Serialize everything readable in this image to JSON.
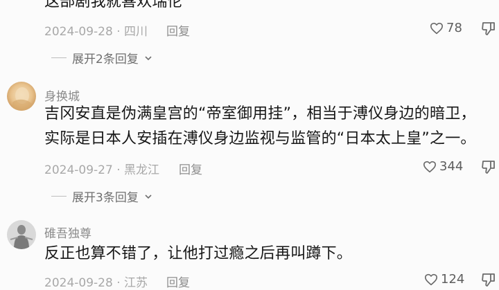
{
  "comments": [
    {
      "lines": [
        "这部剧我就喜欢瑞伦"
      ],
      "date": "2024-09-28",
      "location": "四川",
      "reply_label": "回复",
      "likes": "78",
      "expand_label": "展开2条回复"
    },
    {
      "username": "身换城",
      "lines": [
        "吉冈安直是伪满皇宫的“帝室御用挂”，相当于溥仪身边的暗卫，",
        "实际是日本人安插在溥仪身边监视与监管的“日本太上皇”之一。"
      ],
      "date": "2024-09-27",
      "location": "黑龙江",
      "reply_label": "回复",
      "likes": "344",
      "expand_label": "展开3条回复"
    },
    {
      "username": "碓吾独尊",
      "lines": [
        "反正也算不错了，让他打过瘾之后再叫蹲下。"
      ],
      "date": "2024-09-28",
      "location": "江苏",
      "reply_label": "回复",
      "likes": "124"
    }
  ],
  "icons": {
    "like": "heart-outline-icon",
    "dislike": "thumb-down-outline-icon",
    "expand": "chevron-down-icon"
  },
  "colors": {
    "background": "#fbfbfb",
    "text": "#161616",
    "meta": "#a8a8a8"
  }
}
